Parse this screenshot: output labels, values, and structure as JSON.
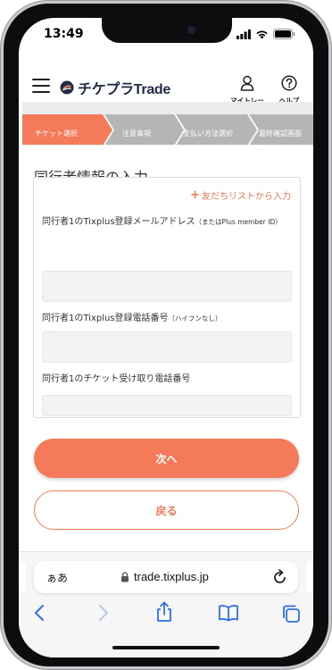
{
  "status": {
    "time": "13:49"
  },
  "header": {
    "brand": "チケプラTrade",
    "mytrade_label": "マイトレード",
    "help_label": "ヘルプ"
  },
  "steps": [
    {
      "label": "チケット選択",
      "active": true
    },
    {
      "label": "注意事項",
      "active": false
    },
    {
      "label": "支払い方法選択",
      "active": false
    },
    {
      "label": "最終確認画面",
      "active": false
    }
  ],
  "section": {
    "title": "同行者情報の入力"
  },
  "form": {
    "add_friend_label": "友だちリストから入力",
    "fields": [
      {
        "label": "同行者1のTixplus登録メールアドレス",
        "note": "（またはPlus member ID）",
        "value": ""
      },
      {
        "label": "同行者1のTixplus登録電話番号",
        "note": "（ハイフンなし）",
        "value": ""
      },
      {
        "label": "同行者1のチケット受け取り電話番号",
        "note": "",
        "value": ""
      }
    ]
  },
  "buttons": {
    "next": "次へ",
    "back": "戻る"
  },
  "browser": {
    "aa": "ぁあ",
    "url": "trade.tixplus.jp"
  },
  "colors": {
    "accent": "#f57a5a",
    "step_active": "#f57a5a",
    "step_inactive": "#b5b5b5"
  }
}
